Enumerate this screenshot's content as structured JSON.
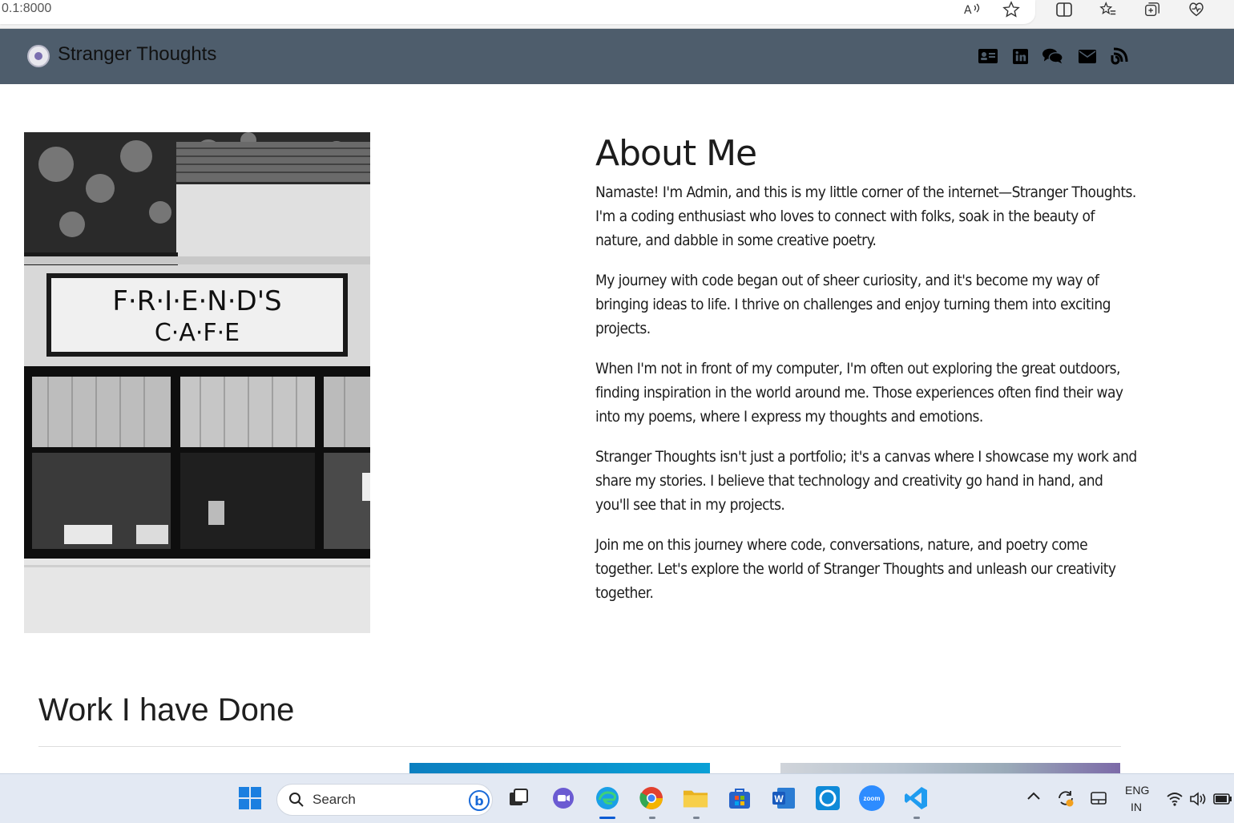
{
  "browser": {
    "address": "0.1:8000",
    "icons": [
      "read-aloud-icon",
      "favorite-star-icon",
      "split-screen-icon",
      "favorites-list-icon",
      "collections-icon",
      "browser-essentials-icon"
    ]
  },
  "navbar": {
    "brand": "Stranger Thoughts",
    "icons": [
      "address-card-icon",
      "linkedin-icon",
      "comments-icon",
      "envelope-icon",
      "blog-icon"
    ]
  },
  "photo": {
    "sign_line1": "F·R·I·E·N·D'S",
    "sign_line2": "C·A·F·E"
  },
  "about": {
    "title": "About Me",
    "paragraphs": [
      "Namaste! I'm Admin, and this is my little corner of the internet—Stranger Thoughts. I'm a coding enthusiast who loves to connect with folks, soak in the beauty of nature, and dabble in some creative poetry.",
      "My journey with code began out of sheer curiosity, and it's become my way of bringing ideas to life. I thrive on challenges and enjoy turning them into exciting projects.",
      "When I'm not in front of my computer, I'm often out exploring the great outdoors, finding inspiration in the world around me. Those experiences often find their way into my poems, where I express my thoughts and emotions.",
      "Stranger Thoughts isn't just a portfolio; it's a canvas where I showcase my work and share my stories. I believe that technology and creativity go hand in hand, and you'll see that in my projects.",
      "Join me on this journey where code, conversations, nature, and poetry come together. Let's explore the world of Stranger Thoughts and unleash our creativity together."
    ]
  },
  "work": {
    "title": "Work I have Done"
  },
  "taskbar": {
    "search_label": "Search",
    "zoom_label": "zoom",
    "lang_line1": "ENG",
    "lang_line2": "IN"
  }
}
